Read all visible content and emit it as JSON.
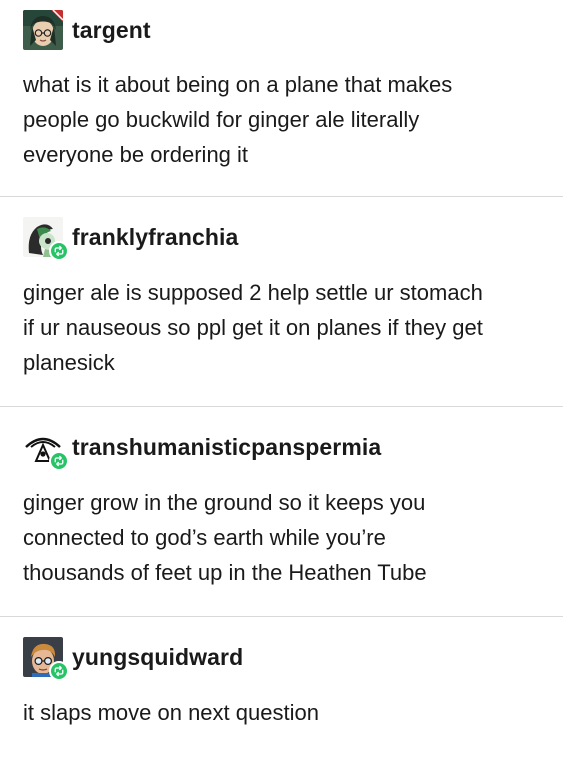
{
  "posts": [
    {
      "username": "targent",
      "avatar_icon": "avatar-targent-icon",
      "reblog": false,
      "lines": [
        "what is it about being on a plane that makes",
        "people go buckwild for ginger ale literally",
        "everyone be ordering it"
      ]
    },
    {
      "username": "franklyfranchia",
      "avatar_icon": "avatar-franklyfranchia-icon",
      "reblog": true,
      "lines": [
        "ginger ale is supposed 2 help settle ur stomach",
        "if ur nauseous so ppl get it on planes if they get",
        "planesick"
      ]
    },
    {
      "username": "transhumanisticpanspermia",
      "avatar_icon": "avatar-transhumanisticpanspermia-icon",
      "reblog": true,
      "lines": [
        "ginger grow in the ground so it keeps you",
        "connected to god’s earth while you’re",
        "thousands of feet up in the Heathen Tube"
      ]
    },
    {
      "username": "yungsquidward",
      "avatar_icon": "avatar-yungsquidward-icon",
      "reblog": true,
      "lines": [
        "it slaps move on next question"
      ]
    }
  ],
  "colors": {
    "reblog_badge": "#26c466",
    "divider": "#d9d9d9",
    "text": "#1a1a1a"
  }
}
